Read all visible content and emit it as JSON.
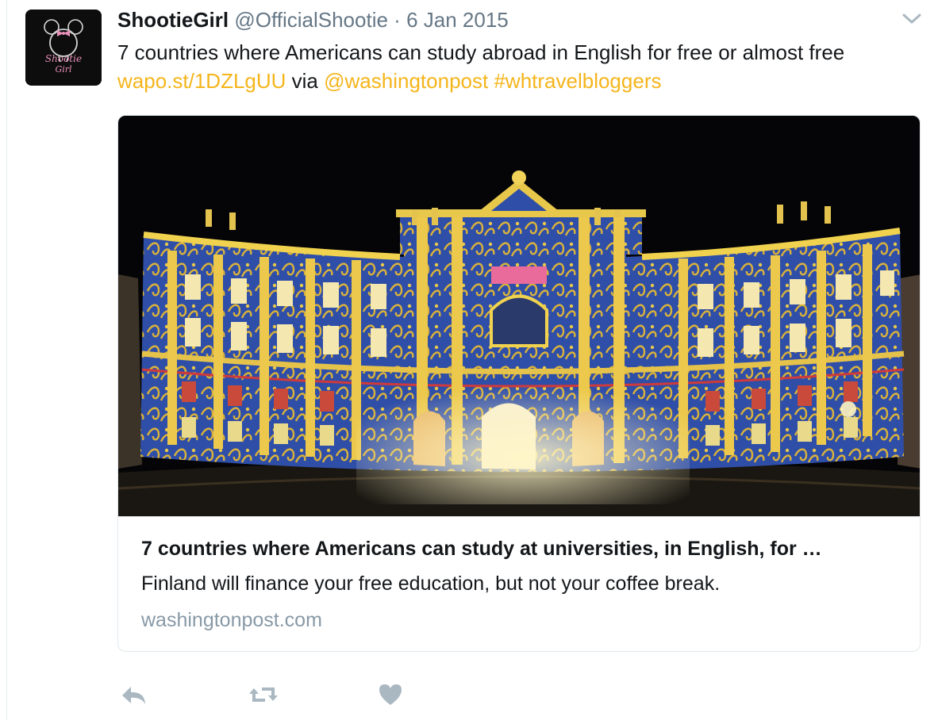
{
  "tweet": {
    "author_name": "ShootieGirl",
    "author_handle": "@OfficialShootie",
    "separator": "·",
    "date": "6 Jan 2015",
    "text": "7 countries where Americans can study abroad in English for free or almost free",
    "short_link": "wapo.st/1DZLgUU",
    "via_word": "via",
    "mention": "@washingtonpost",
    "hashtag": "#whtravelbloggers"
  },
  "avatar": {
    "logo_text_line1": "Shootie",
    "logo_text_line2": "Girl"
  },
  "card": {
    "title": "7 countries where Americans can study at universities, in English, for …",
    "description": "Finland will finance your free education, but not your coffee break.",
    "domain": "washingtonpost.com",
    "image_subject": "illuminated baroque building facade at night with blue and gold projection pattern"
  },
  "actions": [
    {
      "icon": "reply-icon"
    },
    {
      "icon": "retweet-icon"
    },
    {
      "icon": "like-icon"
    }
  ],
  "colors": {
    "link": "#f5b51b",
    "text": "#14171a",
    "muted": "#657786",
    "domain": "#8899a6",
    "border": "#e1e8ed",
    "action_icon": "#aab8c2"
  }
}
